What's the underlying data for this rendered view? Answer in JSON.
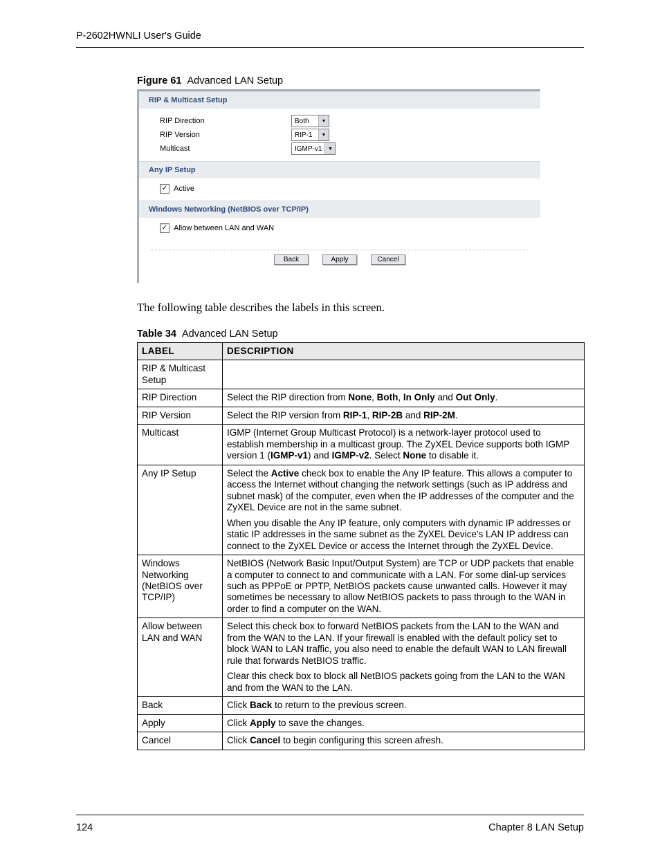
{
  "header": {
    "running": "P-2602HWNLI User's Guide"
  },
  "figure": {
    "label": "Figure 61",
    "title": "Advanced LAN Setup"
  },
  "router_ui": {
    "sections": {
      "rip_multicast": {
        "heading": "RIP & Multicast Setup",
        "rows": {
          "rip_direction": {
            "label": "RIP Direction",
            "value": "Both"
          },
          "rip_version": {
            "label": "RIP Version",
            "value": "RIP-1"
          },
          "multicast": {
            "label": "Multicast",
            "value": "IGMP-v1"
          }
        }
      },
      "any_ip": {
        "heading": "Any IP Setup",
        "checkbox": {
          "label": "Active",
          "checked": true
        }
      },
      "netbios": {
        "heading": "Windows Networking (NetBIOS over TCP/IP)",
        "checkbox": {
          "label": "Allow between LAN and WAN",
          "checked": true
        }
      }
    },
    "buttons": {
      "back": "Back",
      "apply": "Apply",
      "cancel": "Cancel"
    }
  },
  "body_text": "The following table describes the labels in this screen.",
  "table": {
    "label": "Table 34",
    "title": "Advanced LAN Setup",
    "head": {
      "c1": "LABEL",
      "c2": "DESCRIPTION"
    },
    "rows": [
      {
        "label": "RIP & Multicast Setup",
        "desc_html": ""
      },
      {
        "label": "RIP Direction",
        "desc_html": "Select the RIP direction from <b>None</b>, <b>Both</b>, <b>In Only</b> and <b>Out Only</b>."
      },
      {
        "label": "RIP Version",
        "desc_html": "Select the RIP version from <b>RIP-1</b>, <b>RIP-2B</b> and <b>RIP-2M</b>."
      },
      {
        "label": "Multicast",
        "desc_html": "IGMP (Internet Group Multicast Protocol) is a network-layer protocol used to establish membership in a multicast group. The ZyXEL Device supports both IGMP version 1 (<b>IGMP-v1</b>) and <b>IGMP-v2</b>. Select <b>None</b> to disable it."
      },
      {
        "label": "Any IP Setup",
        "desc_html": "<p>Select the <b>Active</b> check box to enable the Any IP feature. This allows a computer to access the Internet without changing the network settings (such as IP address and subnet mask) of the computer, even when the IP addresses of the computer and the ZyXEL Device are not in the same subnet.</p><p>When you disable the Any IP feature, only computers with dynamic IP addresses or static IP addresses in the same subnet as the ZyXEL Device's LAN IP address can connect to the ZyXEL Device or access the Internet through the ZyXEL Device.</p>"
      },
      {
        "label": "Windows Networking (NetBIOS over TCP/IP)",
        "desc_html": "NetBIOS (Network Basic Input/Output System) are TCP or UDP packets that enable a computer to connect to and communicate with a LAN. For some dial-up services such as PPPoE or PPTP, NetBIOS packets cause unwanted calls. However it may sometimes be necessary to allow NetBIOS packets to pass through to the WAN in order to find a computer on the WAN."
      },
      {
        "label": "Allow between LAN and WAN",
        "desc_html": "<p>Select this check box to forward NetBIOS packets from the LAN to the WAN and from the WAN to the LAN. If your firewall is enabled with the default policy set to block WAN to LAN traffic, you also need to enable the default WAN to LAN firewall rule that forwards NetBIOS traffic.</p><p>Clear this check box to block all NetBIOS packets going from the LAN to the WAN and from the WAN to the LAN.</p>"
      },
      {
        "label": "Back",
        "desc_html": "Click <b>Back</b> to return to the previous screen."
      },
      {
        "label": "Apply",
        "desc_html": "Click <b>Apply</b> to save the changes."
      },
      {
        "label": "Cancel",
        "desc_html": "Click <b>Cancel</b> to begin configuring this screen afresh."
      }
    ]
  },
  "footer": {
    "page_num": "124",
    "chapter": "Chapter 8 LAN Setup"
  }
}
